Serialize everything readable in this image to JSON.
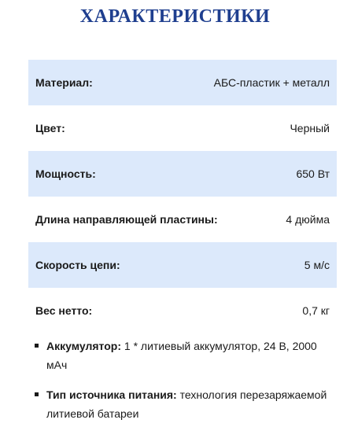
{
  "title": "ХАРАКТЕРИСТИКИ",
  "specs": [
    {
      "label": "Материал:",
      "value": "АБС-пластик + металл"
    },
    {
      "label": "Цвет:",
      "value": "Черный"
    },
    {
      "label": "Мощность:",
      "value": "650 Вт"
    },
    {
      "label": "Длина направляющей пластины:",
      "value": "4 дюйма"
    },
    {
      "label": "Скорость цепи:",
      "value": "5 м/с"
    },
    {
      "label": "Вес нетто:",
      "value": "0,7 кг"
    }
  ],
  "bullets": [
    {
      "label": "Аккумулятор:",
      "text": " 1 * литиевый аккумулятор, 24 В, 2000 мАч"
    },
    {
      "label": "Тип источника питания:",
      "text": " технология перезаряжаемой литиевой батареи"
    }
  ],
  "colors": {
    "title": "#1f3f8f",
    "row_shade": "#dce9fb"
  }
}
